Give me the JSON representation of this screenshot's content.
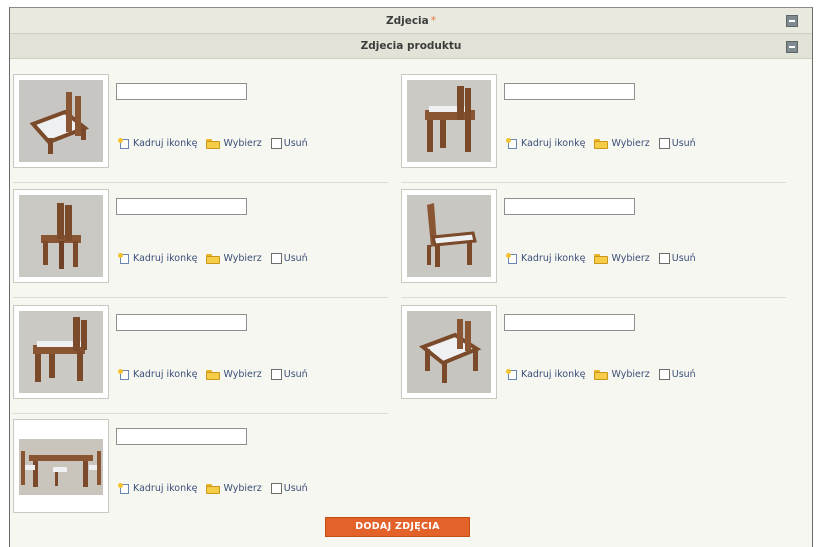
{
  "section_title": "Zdjecia",
  "required_marker": "*",
  "subsection_title": "Zdjecia produktu",
  "actions": {
    "crop_label": "Kadruj ikonkę",
    "choose_label": "Wybierz",
    "delete_label": "Usuń"
  },
  "photos": [
    {
      "name_value": "",
      "description": "chair-angled"
    },
    {
      "name_value": "",
      "description": "chair-side"
    },
    {
      "name_value": "",
      "description": "chair-front"
    },
    {
      "name_value": "",
      "description": "chair-tilted"
    },
    {
      "name_value": "",
      "description": "chair-side-2"
    },
    {
      "name_value": "",
      "description": "chair-back"
    },
    {
      "name_value": "",
      "description": "table-set"
    }
  ],
  "add_button_label": "DODAJ ZDJĘCIA",
  "colors": {
    "header_bg": "#e9e9df",
    "accent": "#e2622a",
    "link": "#3a4f77"
  }
}
